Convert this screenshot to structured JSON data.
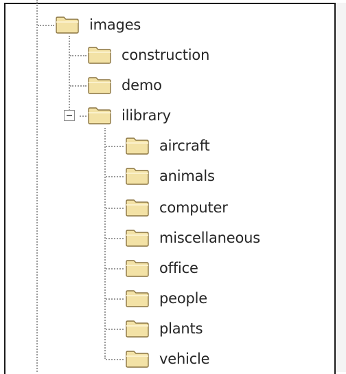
{
  "tree": {
    "root": {
      "label": "images",
      "icon": "folder-icon"
    },
    "children": [
      {
        "label": "construction",
        "icon": "folder-icon"
      },
      {
        "label": "demo",
        "icon": "folder-icon"
      },
      {
        "label": "ilibrary",
        "icon": "folder-icon",
        "expanded": true,
        "toggle_icon": "collapse-minus-icon",
        "children": [
          {
            "label": "aircraft",
            "icon": "folder-icon"
          },
          {
            "label": "animals",
            "icon": "folder-icon"
          },
          {
            "label": "computer",
            "icon": "folder-icon"
          },
          {
            "label": "miscellaneous",
            "icon": "folder-icon"
          },
          {
            "label": "office",
            "icon": "folder-icon"
          },
          {
            "label": "people",
            "icon": "folder-icon"
          },
          {
            "label": "plants",
            "icon": "folder-icon"
          },
          {
            "label": "vehicle",
            "icon": "folder-icon"
          }
        ]
      }
    ]
  },
  "colors": {
    "folder_fill": "#f3e2a6",
    "folder_outline": "#8a7440",
    "connector": "#9a9a9a",
    "text": "#262626"
  }
}
